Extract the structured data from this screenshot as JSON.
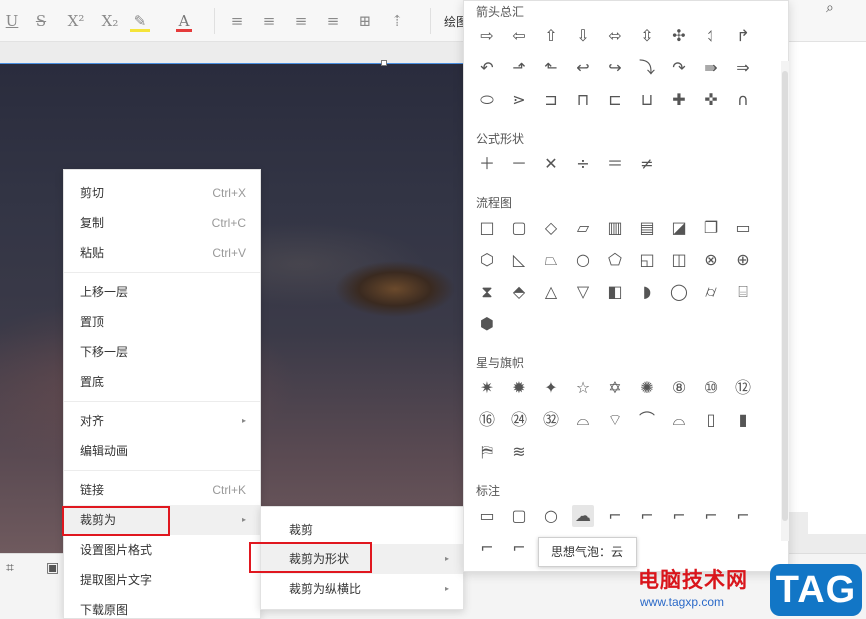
{
  "toolbar": {
    "buttons": [
      {
        "icon": "underline-icon",
        "glyph": "U"
      },
      {
        "icon": "strikethrough-icon",
        "glyph": "S"
      },
      {
        "icon": "superscript-icon",
        "glyph": "X²"
      },
      {
        "icon": "subscript-icon",
        "glyph": "X₂"
      },
      {
        "icon": "highlight-icon",
        "glyph": "✎"
      },
      {
        "icon": "font-color-icon",
        "glyph": "A"
      },
      {
        "icon": "align-left-icon",
        "glyph": "≡"
      },
      {
        "icon": "align-center-icon",
        "glyph": "≡"
      },
      {
        "icon": "align-right-icon",
        "glyph": "≡"
      },
      {
        "icon": "justify-icon",
        "glyph": "≡"
      },
      {
        "icon": "distribute-icon",
        "glyph": "⊞"
      },
      {
        "icon": "line-spacing-icon",
        "glyph": "⇡"
      }
    ],
    "draw_label": "绘图",
    "search_glyph": "⌕"
  },
  "context_menu": {
    "items": [
      {
        "label": "剪切",
        "shortcut": "Ctrl+X"
      },
      {
        "label": "复制",
        "shortcut": "Ctrl+C"
      },
      {
        "label": "粘贴",
        "shortcut": "Ctrl+V"
      },
      {
        "label": "上移一层",
        "shortcut": ""
      },
      {
        "label": "置顶",
        "shortcut": ""
      },
      {
        "label": "下移一层",
        "shortcut": ""
      },
      {
        "label": "置底",
        "shortcut": ""
      },
      {
        "label": "对齐",
        "shortcut": "",
        "submenu": true
      },
      {
        "label": "编辑动画",
        "shortcut": ""
      },
      {
        "label": "链接",
        "shortcut": "Ctrl+K"
      },
      {
        "label": "裁剪为",
        "shortcut": "",
        "submenu": true
      },
      {
        "label": "设置图片格式",
        "shortcut": ""
      },
      {
        "label": "提取图片文字",
        "shortcut": ""
      },
      {
        "label": "下载原图",
        "shortcut": ""
      }
    ],
    "arrow": "▸"
  },
  "submenu": {
    "items": [
      {
        "label": "裁剪",
        "submenu": false
      },
      {
        "label": "裁剪为形状",
        "submenu": true
      },
      {
        "label": "裁剪为纵横比",
        "submenu": true
      }
    ]
  },
  "shapes_panel": {
    "sections": [
      {
        "title": "箭头总汇",
        "glyphs": [
          "⇨",
          "⇦",
          "⇧",
          "⇩",
          "⬄",
          "⇳",
          "✣",
          "⥑",
          "↱",
          "↶",
          "⬏",
          "⬑",
          "↩",
          "↪",
          "⤵",
          "↷",
          "⇛",
          "⇒",
          "⬭",
          "⋗",
          "⊐",
          "⊓",
          "⊏",
          "⊔",
          "✚",
          "✜",
          "∩"
        ]
      },
      {
        "title": "公式形状",
        "glyphs": [
          "＋",
          "－",
          "✕",
          "÷",
          "＝",
          "≠"
        ]
      },
      {
        "title": "流程图",
        "glyphs": [
          "□",
          "▢",
          "◇",
          "▱",
          "▥",
          "▤",
          "◪",
          "❐",
          "▭",
          "⬡",
          "◺",
          "⏢",
          "○",
          "⬠",
          "◱",
          "◫",
          "⊗",
          "⊕",
          "⧗",
          "⬘",
          "△",
          "▽",
          "◧",
          "◗",
          "◯",
          "⌭",
          "⌸",
          "⬢"
        ]
      },
      {
        "title": "星与旗帜",
        "glyphs": [
          "✷",
          "✹",
          "✦",
          "☆",
          "✡",
          "✺",
          "⑧",
          "⑩",
          "⑫",
          "⑯",
          "㉔",
          "㉜",
          "⌓",
          "⌔",
          "⌒",
          "⌓",
          "▯",
          "▮",
          "⛿",
          "≋"
        ]
      },
      {
        "title": "标注",
        "glyphs": [
          "▭",
          "▢",
          "○",
          "☁",
          "⌐",
          "⌐",
          "⌐",
          "⌐",
          "⌐",
          "⌐",
          "⌐",
          "⌐",
          "⌐",
          "⌐"
        ]
      }
    ]
  },
  "tooltip": {
    "text": "思想气泡：云"
  },
  "watermark": {
    "title": "电脑技术网",
    "url": "www.tagxp.com",
    "badge": "TAG"
  }
}
